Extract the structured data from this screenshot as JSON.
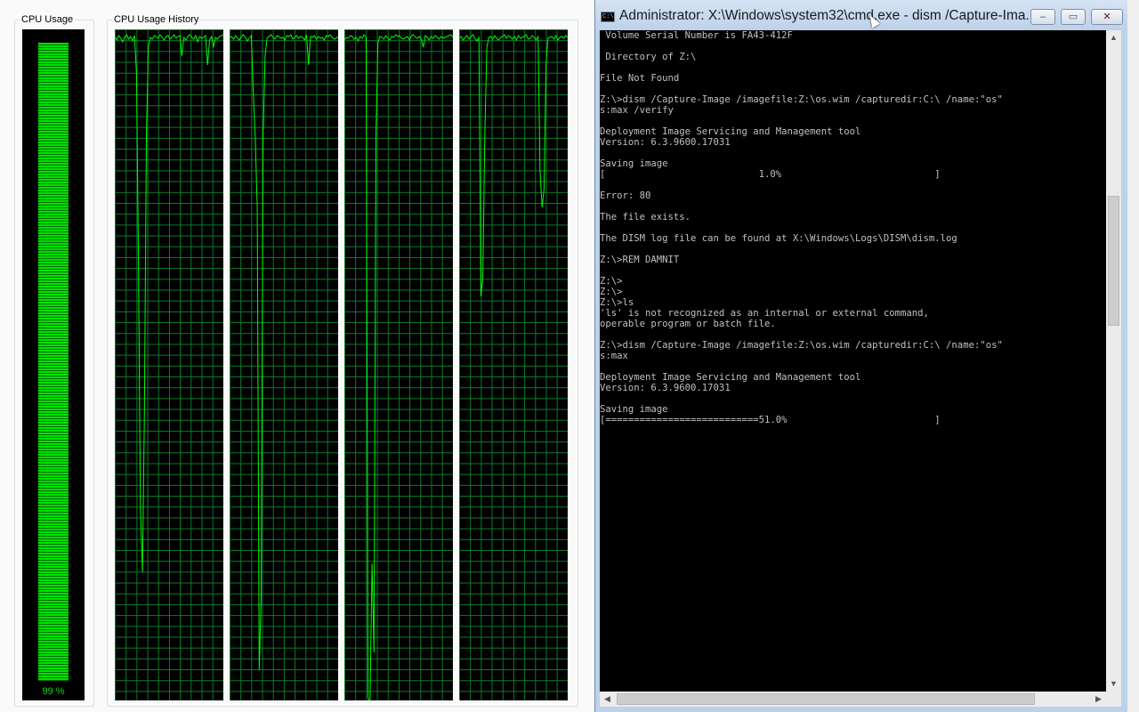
{
  "task_manager": {
    "cpu_usage_label": "CPU Usage",
    "cpu_history_label": "CPU Usage History",
    "cpu_percent_text": "99 %",
    "cpu_level": 0.99,
    "colors": {
      "graph_line": "#00ff00",
      "grid": "#0a7d2c",
      "meter": "#00e000"
    },
    "history": [
      [
        8,
        12,
        7,
        10,
        14,
        9,
        6,
        11,
        8,
        13,
        7,
        50,
        260,
        540,
        610,
        430,
        120,
        20,
        9,
        11,
        7,
        8,
        10,
        6,
        9,
        12,
        8,
        7,
        11,
        9,
        6,
        10,
        8,
        7,
        30,
        9,
        12,
        8,
        6,
        9,
        11,
        7,
        14,
        8,
        10,
        9,
        7,
        40,
        12,
        8,
        20,
        9,
        11,
        8,
        7,
        6
      ],
      [
        9,
        8,
        11,
        7,
        10,
        12,
        8,
        6,
        9,
        13,
        10,
        7,
        70,
        120,
        200,
        720,
        640,
        120,
        30,
        10,
        8,
        6,
        9,
        11,
        7,
        8,
        10,
        9,
        12,
        7,
        8,
        6,
        11,
        9,
        7,
        10,
        8,
        9,
        12,
        6,
        40,
        8,
        9,
        7,
        11,
        8,
        10,
        9,
        12,
        7,
        8,
        6,
        9,
        11,
        10,
        8
      ],
      [
        12,
        9,
        10,
        7,
        8,
        11,
        9,
        13,
        8,
        10,
        6,
        9,
        750,
        760,
        600,
        700,
        120,
        15,
        8,
        9,
        11,
        7,
        10,
        12,
        8,
        9,
        6,
        8,
        7,
        10,
        11,
        9,
        8,
        12,
        7,
        6,
        9,
        10,
        8,
        11,
        20,
        7,
        9,
        12,
        8,
        10,
        7,
        9,
        11,
        8,
        10,
        9,
        8,
        7,
        6,
        9
      ],
      [
        10,
        8,
        12,
        9,
        7,
        11,
        8,
        6,
        10,
        13,
        9,
        300,
        280,
        120,
        20,
        9,
        8,
        11,
        7,
        10,
        12,
        9,
        8,
        6,
        10,
        7,
        9,
        11,
        8,
        12,
        7,
        10,
        9,
        8,
        6,
        11,
        10,
        7,
        9,
        12,
        8,
        160,
        200,
        180,
        40,
        10,
        9,
        8,
        11,
        7,
        12,
        9,
        8,
        10,
        7,
        9
      ]
    ]
  },
  "cmd": {
    "title": "Administrator: X:\\Windows\\system32\\cmd.exe - dism  /Capture-Ima...",
    "icon_text": "C:\\",
    "minimize": "–",
    "maximize": "▭",
    "close": "✕",
    "lines": [
      " Volume Serial Number is FA43-412F",
      "",
      " Directory of Z:\\",
      "",
      "File Not Found",
      "",
      "Z:\\>dism /Capture-Image /imagefile:Z:\\os.wim /capturedir:C:\\ /name:\"os\"",
      "s:max /verify",
      "",
      "Deployment Image Servicing and Management tool",
      "Version: 6.3.9600.17031",
      "",
      "Saving image",
      "[                           1.0%                           ]",
      "",
      "Error: 80",
      "",
      "The file exists.",
      "",
      "The DISM log file can be found at X:\\Windows\\Logs\\DISM\\dism.log",
      "",
      "Z:\\>REM DAMNIT",
      "",
      "Z:\\>",
      "Z:\\>",
      "Z:\\>ls",
      "'ls' is not recognized as an internal or external command,",
      "operable program or batch file.",
      "",
      "Z:\\>dism /Capture-Image /imagefile:Z:\\os.wim /capturedir:C:\\ /name:\"os\"",
      "s:max",
      "",
      "Deployment Image Servicing and Management tool",
      "Version: 6.3.9600.17031",
      "",
      "Saving image",
      "[===========================51.0%                          ]"
    ],
    "progress_percent": 51.0
  }
}
